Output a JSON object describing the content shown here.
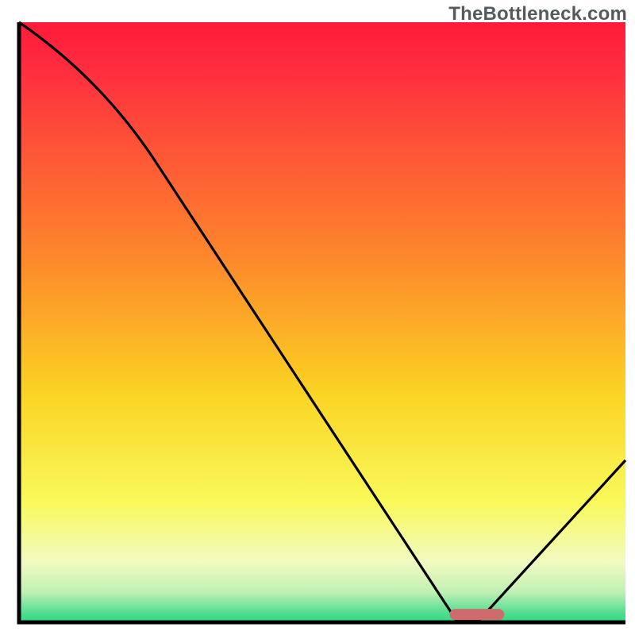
{
  "watermark": "TheBottleneck.com",
  "chart_data": {
    "type": "line",
    "title": "",
    "xlabel": "",
    "ylabel": "",
    "xlim": [
      0,
      100
    ],
    "ylim": [
      0,
      100
    ],
    "x": [
      0,
      23,
      72,
      76,
      100
    ],
    "values": [
      100,
      76,
      0.5,
      0.5,
      27
    ],
    "marker": {
      "x_start": 71,
      "x_end": 80,
      "y": 1.3
    },
    "background": {
      "stops": [
        {
          "pct": 0.0,
          "color": "#ff1a3a"
        },
        {
          "pct": 0.08,
          "color": "#ff2e3f"
        },
        {
          "pct": 0.4,
          "color": "#fd8a2b"
        },
        {
          "pct": 0.62,
          "color": "#fbd423"
        },
        {
          "pct": 0.8,
          "color": "#f9f95b"
        },
        {
          "pct": 0.9,
          "color": "#f1fac1"
        },
        {
          "pct": 0.95,
          "color": "#bff0b4"
        },
        {
          "pct": 0.985,
          "color": "#4fdd8f"
        },
        {
          "pct": 1.0,
          "color": "#2fd883"
        }
      ]
    },
    "axes_color": "#000000",
    "line_color": "#000000",
    "marker_color": "#cf6b6d"
  }
}
